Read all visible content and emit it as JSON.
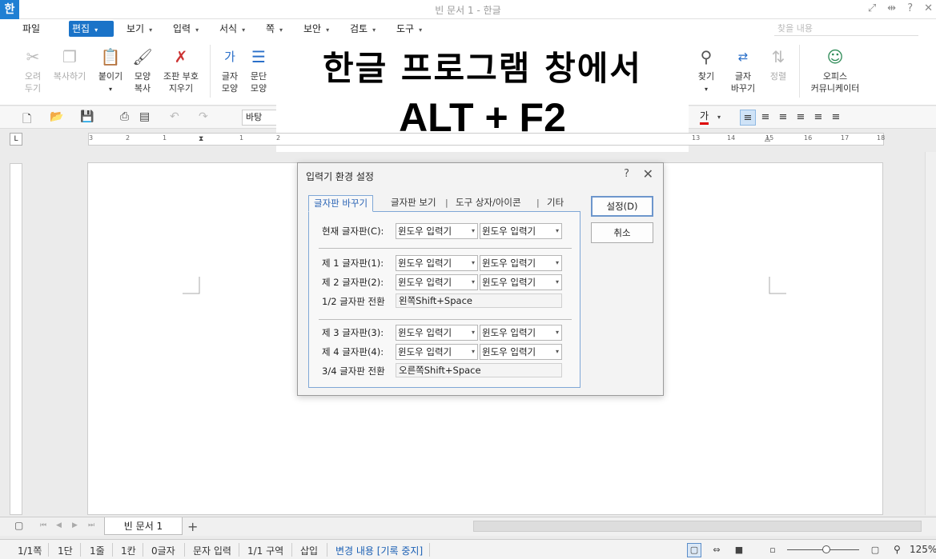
{
  "titlebar": {
    "icon": "한",
    "title": "빈 문서 1 - 한글",
    "help": "?",
    "close": "✕"
  },
  "menu": {
    "file": "파일",
    "items": [
      {
        "label": "편집",
        "active": true
      },
      {
        "label": "보기"
      },
      {
        "label": "입력"
      },
      {
        "label": "서식"
      },
      {
        "label": "쪽"
      },
      {
        "label": "보안"
      },
      {
        "label": "검토"
      },
      {
        "label": "도구"
      }
    ],
    "search_placeholder": "찾을 내용"
  },
  "ribbon": {
    "cut": "오려\n두기",
    "copy": "복사하기",
    "paste": "붙이기",
    "format_copy": "모양\n복사",
    "erase_marks": "조판 부호\n지우기",
    "char_shape": "글자\n모양",
    "para_shape": "문단\n모양",
    "find": "찾기",
    "replace": "글자\n바꾸기",
    "sort": "정렬",
    "office_comm": "오피스\n커뮤니케이터"
  },
  "banner": {
    "line1": "한글 프로그램 창에서",
    "line2": "ALT + F2"
  },
  "toolbar2": {
    "style": "바탕",
    "font_color_glyph": "가"
  },
  "ruler": {
    "ticks": [
      "3",
      "2",
      "1",
      "1",
      "2",
      "3",
      "13",
      "14",
      "15",
      "16",
      "17",
      "18"
    ]
  },
  "dialog": {
    "title": "입력기 환경 설정",
    "help": "?",
    "close": "✕",
    "tabs": [
      "글자판 바꾸기",
      "글자판 보기",
      "도구 상자/아이콘",
      "기타"
    ],
    "rows": {
      "current": {
        "label": "현재 글자판(C):",
        "a": "윈도우 입력기",
        "b": "윈도우 입력기"
      },
      "first": {
        "label": "제 1 글자판(1):",
        "a": "윈도우 입력기",
        "b": "윈도우 입력기"
      },
      "second": {
        "label": "제 2 글자판(2):",
        "a": "윈도우 입력기",
        "b": "윈도우 입력기"
      },
      "switch12": {
        "label": "1/2 글자판 전환",
        "value": "왼쪽Shift+Space"
      },
      "third": {
        "label": "제 3 글자판(3):",
        "a": "윈도우 입력기",
        "b": "윈도우 입력기"
      },
      "fourth": {
        "label": "제 4 글자판(4):",
        "a": "윈도우 입력기",
        "b": "윈도우 입력기"
      },
      "switch34": {
        "label": "3/4 글자판 전환",
        "value": "오른쪽Shift+Space"
      }
    },
    "ok": "설정(D)",
    "cancel": "취소"
  },
  "sheet": {
    "tab": "빈 문서 1",
    "add": "+"
  },
  "status": {
    "page": "1/1쪽",
    "section_col": "1단",
    "line": "1줄",
    "col": "1칸",
    "chars": "0글자",
    "input_mode": "문자 입력",
    "region": "1/1 구역",
    "insert": "삽입",
    "track": "변경 내용 [기록 중지]",
    "zoom": "125%"
  }
}
